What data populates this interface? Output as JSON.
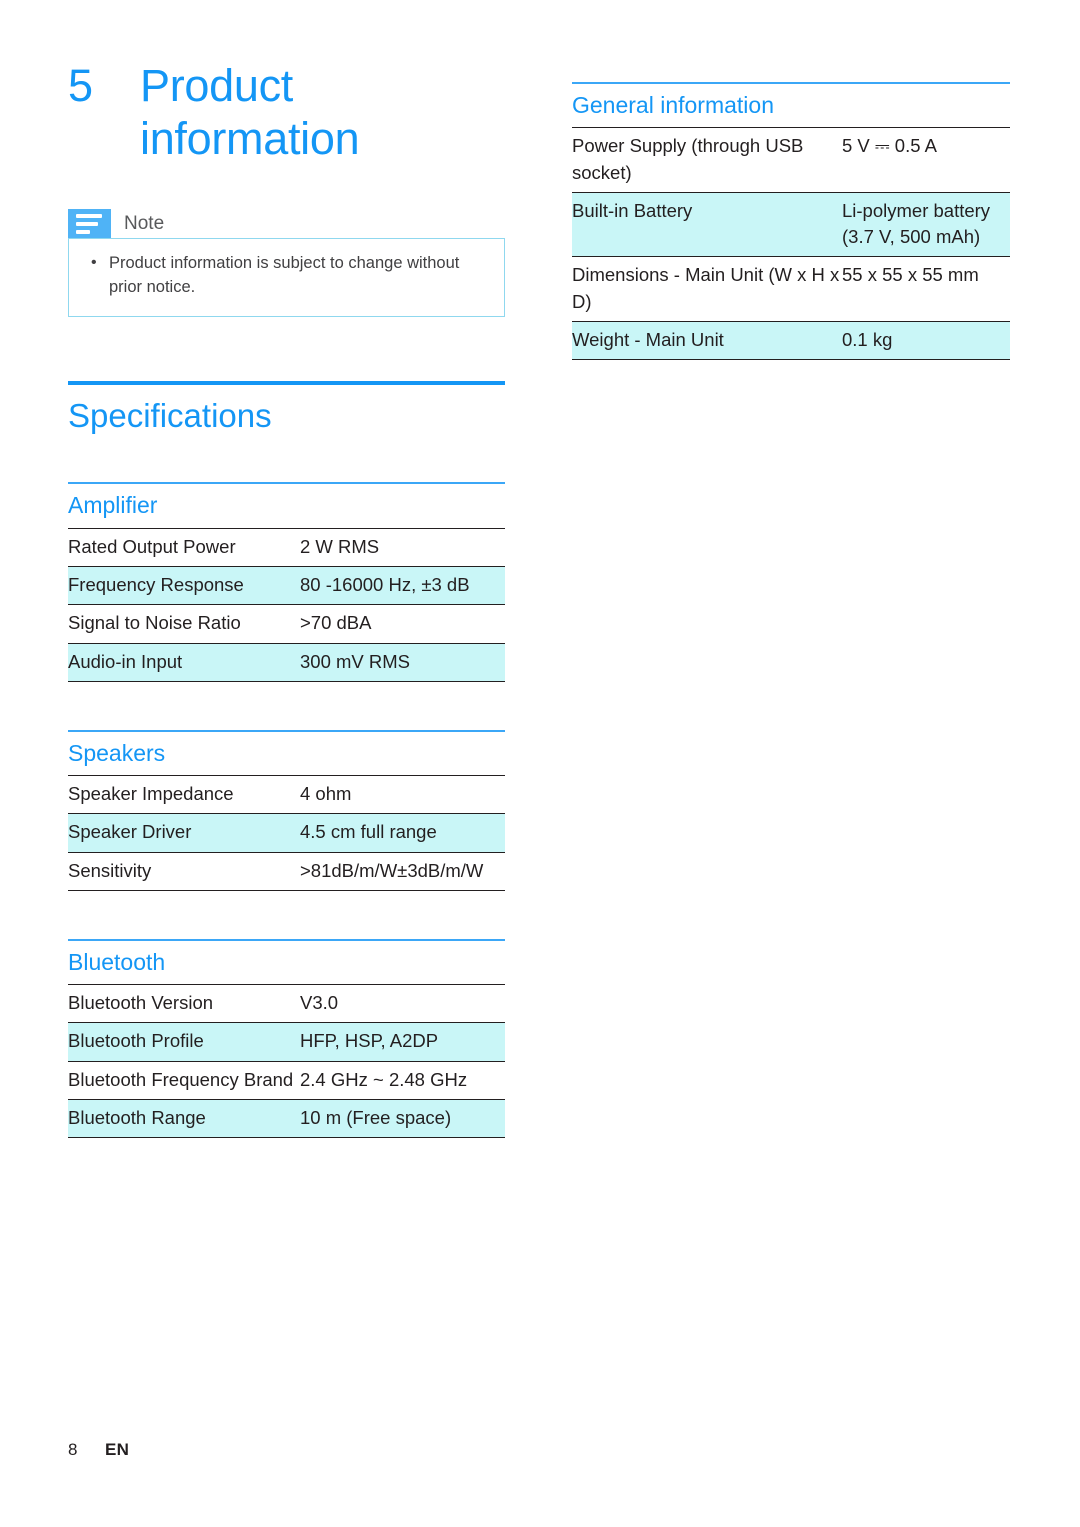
{
  "colors": {
    "accent_blue": "#1496f5",
    "rule_blue": "#3ba7f7",
    "row_highlight": "#c9f6f7",
    "note_icon_blue": "#4fb3f6",
    "note_border": "#8fd8ef",
    "text": "#231f20"
  },
  "chapter": {
    "number": "5",
    "title_line1": "Product",
    "title_line2": "information"
  },
  "note": {
    "icon": "note-lines-icon",
    "label": "Note",
    "items": [
      "Product information is subject to change without prior notice."
    ]
  },
  "specifications": {
    "heading": "Specifications",
    "sections": [
      {
        "heading": "Amplifier",
        "rows": [
          {
            "key": "Rated Output Power",
            "value": "2 W RMS",
            "highlight": false
          },
          {
            "key": "Frequency Response",
            "value": "80 -16000 Hz, ±3 dB",
            "highlight": true
          },
          {
            "key": "Signal to Noise Ratio",
            "value": ">70 dBA",
            "highlight": false
          },
          {
            "key": "Audio-in Input",
            "value": "300 mV RMS",
            "highlight": true
          }
        ]
      },
      {
        "heading": "Speakers",
        "rows": [
          {
            "key": "Speaker Impedance",
            "value": "4 ohm",
            "highlight": false
          },
          {
            "key": "Speaker Driver",
            "value": "4.5 cm full range",
            "highlight": true
          },
          {
            "key": "Sensitivity",
            "value": ">81dB/m/W±3dB/m/W",
            "highlight": false
          }
        ]
      },
      {
        "heading": "Bluetooth",
        "rows": [
          {
            "key": "Bluetooth Version",
            "value": "V3.0",
            "highlight": false
          },
          {
            "key": "Bluetooth Profile",
            "value": "HFP, HSP, A2DP",
            "highlight": true
          },
          {
            "key": "Bluetooth Frequency Brand",
            "value": "2.4 GHz ~ 2.48 GHz",
            "highlight": false
          },
          {
            "key": "Bluetooth Range",
            "value": "10 m (Free space)",
            "highlight": true
          }
        ]
      }
    ]
  },
  "general_information": {
    "heading": "General information",
    "rows": [
      {
        "key": "Power Supply (through USB socket)",
        "value": "5 V ⎓ 0.5 A",
        "highlight": false
      },
      {
        "key": "Built-in Battery",
        "value": "Li-polymer battery (3.7 V, 500 mAh)",
        "highlight": true
      },
      {
        "key": "Dimensions - Main Unit (W x H x D)",
        "value": "55 x 55 x 55 mm",
        "highlight": false
      },
      {
        "key": "Weight - Main Unit",
        "value": "0.1 kg",
        "highlight": true
      }
    ]
  },
  "footer": {
    "page_number": "8",
    "language": "EN"
  }
}
